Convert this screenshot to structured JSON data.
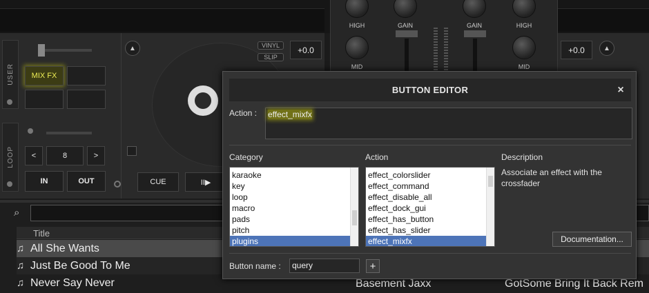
{
  "deck_left": {
    "side_tabs": {
      "user": "USER",
      "loop": "LOOP"
    },
    "pads": {
      "mix_fx": "MIX FX"
    },
    "loop": {
      "prev": "<",
      "size": "8",
      "next": ">",
      "in": "IN",
      "out": "OUT"
    },
    "transport": {
      "cue": "CUE",
      "play": "II▶"
    },
    "pills": {
      "vinyl": "VINYL",
      "slip": "SLIP"
    },
    "pitch": "+0.0"
  },
  "mixer": {
    "labels": {
      "high_l": "HIGH",
      "gain_l": "GAIN",
      "gain_r": "GAIN",
      "high_r": "HIGH",
      "mid_l": "MID",
      "mid_r": "MID"
    }
  },
  "deck_right": {
    "pitch": "+0.0"
  },
  "browser": {
    "column_title": "Title",
    "tracks": [
      {
        "title": "All She Wants",
        "artist": "",
        "remix": ""
      },
      {
        "title": "Just Be Good To Me",
        "artist": "",
        "remix": ""
      },
      {
        "title": "Never Say Never",
        "artist": "Basement Jaxx",
        "remix": "GotSome Bring It Back Rem"
      }
    ]
  },
  "dialog": {
    "title": "BUTTON EDITOR",
    "close": "×",
    "action_label": "Action :",
    "action_value": "effect_mixfx",
    "headers": {
      "category": "Category",
      "action": "Action",
      "description": "Description"
    },
    "categories": [
      "karaoke",
      "key",
      "loop",
      "macro",
      "pads",
      "pitch",
      "plugins"
    ],
    "actions": [
      "effect_colorslider",
      "effect_command",
      "effect_disable_all",
      "effect_dock_gui",
      "effect_has_button",
      "effect_has_slider",
      "effect_mixfx"
    ],
    "description": "Associate an effect with the crossfader",
    "documentation_button": "Documentation...",
    "button_name_label": "Button name :",
    "button_name_value": "query",
    "add_button": "+"
  },
  "colors": {
    "highlight": "#ffff00",
    "selection": "#4d74b8"
  }
}
